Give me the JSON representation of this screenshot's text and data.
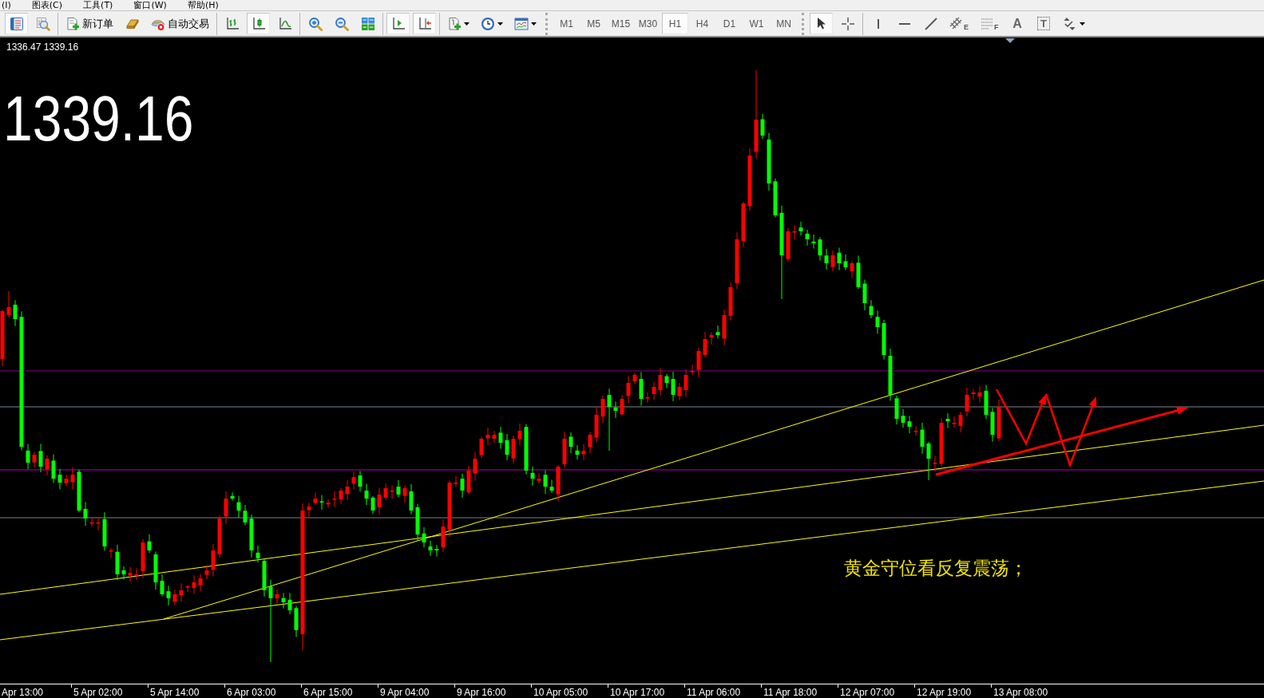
{
  "menu": [
    "(I)",
    "图表(C)",
    "工具(T)",
    "窗口(W)",
    "帮助(H)"
  ],
  "toolbar": {
    "groups": [
      {
        "buttons": [
          {
            "kind": "button",
            "selected": true
          },
          {
            "kind": "button",
            "selected": false
          }
        ]
      },
      {
        "buttons": [
          {
            "kind": "button",
            "label": "新订单",
            "selected": false
          },
          {
            "kind": "button",
            "selected": false
          },
          {
            "kind": "button",
            "label": "自动交易",
            "selected": false
          }
        ]
      },
      {
        "buttons": [
          {
            "kind": "button",
            "selected": false
          },
          {
            "kind": "button",
            "selected": true
          },
          {
            "kind": "button",
            "selected": false
          }
        ]
      },
      {
        "buttons": [
          {
            "kind": "button",
            "selected": false
          },
          {
            "kind": "button",
            "selected": false
          },
          {
            "kind": "button",
            "selected": false
          }
        ]
      },
      {
        "buttons": [
          {
            "kind": "button",
            "selected": true
          },
          {
            "kind": "button",
            "selected": true
          }
        ]
      },
      {
        "buttons": [
          {
            "kind": "dropdown",
            "selected": false
          },
          {
            "kind": "dropdown",
            "selected": false
          },
          {
            "kind": "dropdown",
            "selected": false
          }
        ]
      }
    ],
    "timeframes": [
      {
        "label": "M1",
        "selected": false
      },
      {
        "label": "M5",
        "selected": false
      },
      {
        "label": "M15",
        "selected": false
      },
      {
        "label": "M30",
        "selected": false
      },
      {
        "label": "H1",
        "selected": true
      },
      {
        "label": "H4",
        "selected": false
      },
      {
        "label": "D1",
        "selected": false
      },
      {
        "label": "W1",
        "selected": false
      },
      {
        "label": "MN",
        "selected": false
      }
    ],
    "tools": [
      {
        "buttons": [
          {
            "kind": "button",
            "selected": true
          },
          {
            "kind": "button",
            "selected": false
          }
        ]
      },
      {
        "buttons": [
          {
            "kind": "button",
            "selected": false
          },
          {
            "kind": "button",
            "selected": false
          },
          {
            "kind": "button",
            "selected": false
          },
          {
            "kind": "button",
            "glyph": "E",
            "selected": false
          },
          {
            "kind": "button",
            "glyph": "F",
            "selected": false
          },
          {
            "kind": "button",
            "glyph": "A",
            "selected": false
          },
          {
            "kind": "button",
            "glyph": "T",
            "selected": false
          },
          {
            "kind": "dropdown",
            "selected": false
          }
        ]
      }
    ]
  },
  "chart": {
    "quote_line": "1336.47 1339.16",
    "price_label": "1339.16",
    "annotation": "黄金守位看反复震荡；",
    "time_axis": [
      "Apr 13:00",
      "5 Apr 02:00",
      "5 Apr 14:00",
      "6 Apr 03:00",
      "6 Apr 15:00",
      "9 Apr 04:00",
      "9 Apr 16:00",
      "10 Apr 05:00",
      "10 Apr 17:00",
      "11 Apr 06:00",
      "11 Apr 18:00",
      "12 Apr 07:00",
      "12 Apr 19:00",
      "13 Apr 08:00"
    ]
  }
}
